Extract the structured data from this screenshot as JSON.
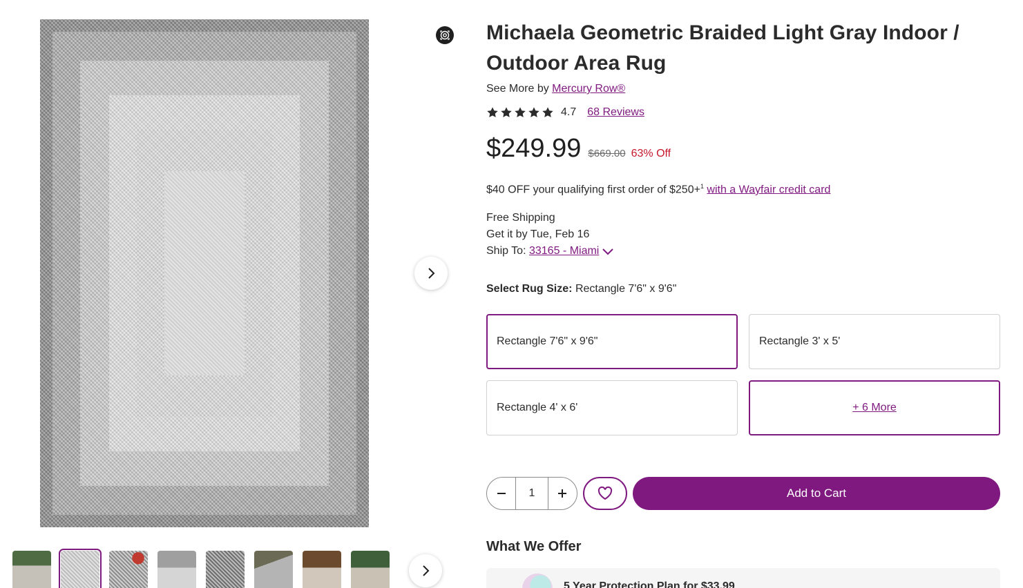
{
  "product": {
    "title": "Michaela Geometric Braided Light Gray Indoor / Outdoor Area Rug",
    "see_more_prefix": "See More by",
    "brand": "Mercury Row®",
    "rating": "4.7",
    "stars": 5,
    "reviews_label": "68 Reviews",
    "price": "$249.99",
    "original_price": "$669.00",
    "discount": "63% Off"
  },
  "promo": {
    "text": "$40 OFF your qualifying first order of $250+",
    "footnote": "1",
    "link": "with a Wayfair credit card"
  },
  "shipping": {
    "free_label": "Free Shipping",
    "delivery": "Get it by Tue, Feb 16",
    "ship_to_label": "Ship To:",
    "ship_to_value": "33165 - Miami"
  },
  "size": {
    "label": "Select Rug Size:",
    "selected": "Rectangle 7'6\" x 9'6\"",
    "options": [
      "Rectangle 7'6\" x 9'6\"",
      "Rectangle 3' x 5'",
      "Rectangle 4' x 6'"
    ],
    "more_label": "+ 6 More"
  },
  "cart": {
    "quantity": "1",
    "add_to_cart": "Add to Cart"
  },
  "offer": {
    "heading": "What We Offer",
    "protection_plan": "5 Year Protection Plan for $33.99"
  },
  "gallery": {
    "thumbnail_count": 8,
    "selected_thumbnail": 2
  },
  "colors": {
    "accent": "#7f187f",
    "discount": "#c7162b"
  }
}
